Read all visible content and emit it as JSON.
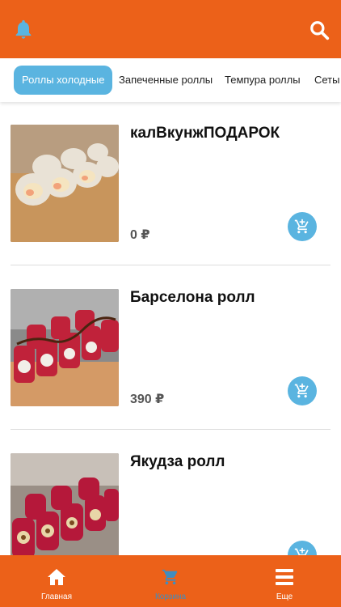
{
  "header": {
    "notifications_icon": "bell-icon",
    "search_icon": "search-icon",
    "color": "#ec6119"
  },
  "categories": [
    {
      "label": "Роллы холодные",
      "active": true
    },
    {
      "label": "Запеченные роллы",
      "active": false
    },
    {
      "label": "Темпура роллы",
      "active": false
    },
    {
      "label": "Сеты",
      "active": false
    }
  ],
  "accent_color": "#5ab4e0",
  "products": [
    {
      "name": "калВкунжПОДАРОК",
      "price": "0 ₽",
      "add_icon": "add-to-cart-icon"
    },
    {
      "name": "Барселона ролл",
      "price": "390 ₽",
      "add_icon": "add-to-cart-icon"
    },
    {
      "name": "Якудза ролл",
      "price": "",
      "add_icon": "add-to-cart-icon"
    }
  ],
  "bottom_nav": [
    {
      "label": "Главная",
      "icon": "home-icon",
      "active": true
    },
    {
      "label": "Корзина",
      "icon": "cart-icon",
      "active": false
    },
    {
      "label": "Еще",
      "icon": "menu-icon",
      "active": true
    }
  ]
}
